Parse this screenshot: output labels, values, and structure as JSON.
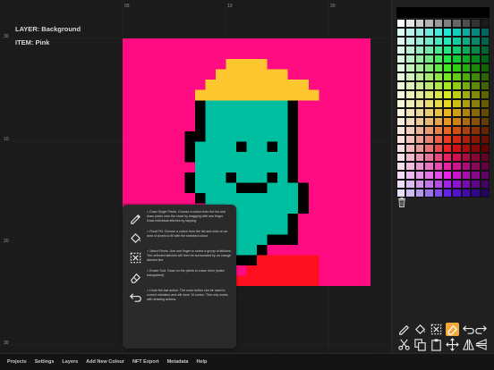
{
  "layer_info": {
    "layer": "LAYER: Background",
    "item": "ITEM:  Pink"
  },
  "rulers": {
    "top": [
      "05",
      "10",
      "20"
    ],
    "left": [
      "30",
      "10",
      "20",
      "30"
    ]
  },
  "help_popup": {
    "items": [
      {
        "icon": "pencil-icon",
        "text": "= Draw Single Pixels. Choose a colour from the list and draw pixels onto the chart by dragging with one finger. Draw individual stitches by tapping."
      },
      {
        "icon": "fill-bucket-icon",
        "text": "= Flood Fill. Choose a colour from the list and click on an area of pixels to fill with the selected colour"
      },
      {
        "icon": "select-icon",
        "text": "= Select Pixels. Use one finger to select a group of stitches. The selected stitches will then be surrounded by an orange dashed line"
      },
      {
        "icon": "eraser-icon",
        "text": "= Eraser Tool. Draw on the pixels to erase them (make transparent)"
      },
      {
        "icon": "undo-icon",
        "text": "= Undo the last action. The undo button can be used to correct mistakes and will store 10 undos. This only works with drawing actions"
      }
    ]
  },
  "bottom_menu": [
    "Projects",
    "Settings",
    "Layers",
    "Add New Colour",
    "NFT Export",
    "Metadata",
    "Help"
  ],
  "colors": {
    "background_pink": "#ff0c82",
    "skin_teal": "#00bfa0",
    "hat_yellow": "#ffc72f",
    "outline_black": "#000000",
    "shirt_red": "#ff1020",
    "active_tool": "#f2a93a"
  },
  "tools": [
    {
      "icon": "pencil-icon"
    },
    {
      "icon": "fill-bucket-icon"
    },
    {
      "icon": "select-icon"
    },
    {
      "icon": "eraser-icon",
      "active": true
    },
    {
      "icon": "undo-icon"
    },
    {
      "icon": "redo-icon"
    },
    {
      "icon": "scissors-icon"
    },
    {
      "icon": "copy-icon"
    },
    {
      "icon": "paste-icon"
    },
    {
      "icon": "move-icon"
    },
    {
      "icon": "flip-horizontal-icon"
    },
    {
      "icon": "flip-vertical-icon"
    }
  ]
}
